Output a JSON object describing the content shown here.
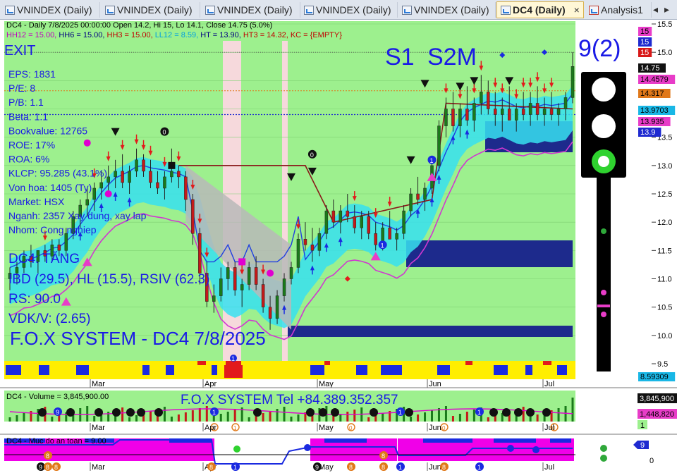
{
  "tabs": [
    {
      "label": "VNINDEX (Daily)"
    },
    {
      "label": "VNINDEX (Daily)"
    },
    {
      "label": "VNINDEX (Daily)"
    },
    {
      "label": "VNINDEX (Daily)"
    },
    {
      "label": "VNINDEX (Daily)"
    },
    {
      "label": "DC4 (Daily)",
      "close": "×"
    },
    {
      "label": "Analysis1"
    }
  ],
  "header": {
    "line1": "DC4 - Daily 7/8/2025 00:00:00 Open 14.2, Hi 15, Lo 14.1, Close 14.75 (5.0%)",
    "line2": [
      {
        "text": "HH12 = 15.00, ",
        "color": "#c000c0"
      },
      {
        "text": "HH6 = 15.00, ",
        "color": "#000080"
      },
      {
        "text": "HH3 = 15.00, ",
        "color": "#c00000"
      },
      {
        "text": "LL12 = 8.59, ",
        "color": "#00a0e0"
      },
      {
        "text": "HT  = 13.90, ",
        "color": "#000080"
      },
      {
        "text": "HT3  = 14.32, ",
        "color": "#c00000"
      },
      {
        "text": "KC = {EMPTY}",
        "color": "#c00000"
      }
    ]
  },
  "signal": {
    "exit": "EXIT",
    "s1": "S1",
    "s2m": "S2M",
    "score": "9(2)"
  },
  "fundamentals": [
    "EPS: 1831",
    "P/E: 8",
    "P/B: 1.1",
    "Beta: 1.1",
    "Bookvalue: 12765",
    "ROE: 17%",
    "ROA: 6%",
    "KLCP: 95.285 (43.1%)",
    "Von hoa: 1405 (Ty)",
    "Market: HSX",
    "Nganh: 2357 Xay dung, xay lap",
    "Nhom: Cong nghiep"
  ],
  "status": {
    "trend": "DC4: TĂNG",
    "ibd": "IBD (29.5), HL (15.5), RSIV (62.3)",
    "rs": "RS: 90.0",
    "vdk": "VDK/V:  (2.65)"
  },
  "system_title": "F.O.X SYSTEM - DC4 7/8/2025",
  "volume_panel": {
    "label": "DC4 - Volume = 3,845,900.00",
    "banner": "F.O.X SYSTEM Tel +84.389.352.357",
    "badge_top": "3,845,900",
    "badge_mid": "1,448,820",
    "badge_low": "1"
  },
  "safety_panel": {
    "label": "DC4 - Muc do an toan = 9.00",
    "badge": "9",
    "axis_zero": "0"
  },
  "price_axis": {
    "ticks": [
      "15.5",
      "15.0",
      "14.5",
      "14.0",
      "13.5",
      "13.0",
      "12.5",
      "12.0",
      "11.5",
      "11.0",
      "10.5",
      "10.0",
      "9.5"
    ],
    "badges": [
      {
        "text": "15",
        "bg": "#e83cc8"
      },
      {
        "text": "15",
        "bg": "#1e2ad0"
      },
      {
        "text": "15",
        "bg": "#d81818"
      },
      {
        "text": "14.75",
        "bg": "#111111"
      },
      {
        "text": "14.4579",
        "bg": "#e83cc8"
      },
      {
        "text": "14.317",
        "bg": "#e0781a"
      },
      {
        "text": "13.9703",
        "bg": "#19b7e6"
      },
      {
        "text": "13.935",
        "bg": "#e83cc8"
      },
      {
        "text": "13.9",
        "bg": "#1e2ad0"
      },
      {
        "text": "8.59309",
        "bg": "#19b7e6"
      }
    ]
  },
  "months": [
    "Mar",
    "Apr",
    "May",
    "Jun",
    "Jul"
  ],
  "markers": {
    "zero": "0",
    "one": "1",
    "eight": "8",
    "nine": "9"
  },
  "chart_data": {
    "type": "candlestick",
    "yrange": [
      9.5,
      15.5
    ],
    "candles": [
      [
        11.0,
        11.2,
        10.8,
        11.1
      ],
      [
        11.1,
        11.3,
        10.9,
        11.2
      ],
      [
        11.2,
        11.5,
        11.1,
        11.4
      ],
      [
        11.4,
        11.6,
        11.2,
        11.3
      ],
      [
        11.3,
        11.5,
        11.1,
        11.5
      ],
      [
        11.5,
        11.6,
        11.3,
        11.4
      ],
      [
        11.4,
        11.7,
        11.3,
        11.6
      ],
      [
        11.6,
        11.7,
        11.4,
        11.5
      ],
      [
        11.5,
        11.9,
        11.4,
        11.8
      ],
      [
        11.8,
        12.2,
        11.7,
        12.1
      ],
      [
        12.1,
        12.4,
        11.9,
        12.3
      ],
      [
        12.3,
        12.6,
        12.1,
        12.4
      ],
      [
        12.4,
        12.7,
        12.2,
        12.6
      ],
      [
        12.6,
        12.9,
        12.4,
        12.7
      ],
      [
        12.7,
        13.0,
        12.5,
        12.8
      ],
      [
        12.8,
        13.1,
        12.6,
        12.9
      ],
      [
        12.9,
        13.2,
        12.6,
        12.7
      ],
      [
        12.7,
        13.0,
        12.5,
        12.9
      ],
      [
        12.9,
        13.3,
        12.8,
        13.1
      ],
      [
        13.1,
        13.2,
        12.8,
        12.9
      ],
      [
        12.9,
        13.1,
        12.6,
        12.7
      ],
      [
        12.7,
        12.9,
        12.5,
        12.6
      ],
      [
        12.6,
        12.9,
        12.4,
        12.8
      ],
      [
        12.8,
        13.3,
        12.7,
        12.9
      ],
      [
        12.9,
        13.0,
        12.6,
        12.8
      ],
      [
        12.8,
        12.9,
        12.2,
        12.4
      ],
      [
        12.4,
        12.5,
        11.6,
        11.8
      ],
      [
        11.8,
        11.9,
        10.9,
        11.1
      ],
      [
        11.1,
        11.3,
        10.5,
        10.6
      ],
      [
        10.6,
        10.9,
        10.4,
        10.7
      ],
      [
        10.7,
        11.2,
        10.6,
        11.0
      ],
      [
        11.0,
        11.3,
        10.8,
        11.2
      ],
      [
        11.2,
        11.3,
        10.7,
        10.8
      ],
      [
        10.8,
        11.0,
        10.5,
        10.9
      ],
      [
        10.9,
        11.3,
        10.8,
        11.2
      ],
      [
        11.2,
        11.4,
        10.8,
        10.9
      ],
      [
        10.9,
        11.0,
        10.4,
        10.5
      ],
      [
        10.5,
        10.7,
        10.1,
        10.3
      ],
      [
        10.3,
        10.8,
        10.2,
        10.7
      ],
      [
        10.7,
        11.1,
        10.6,
        11.0
      ],
      [
        11.0,
        11.3,
        10.9,
        11.2
      ],
      [
        11.2,
        11.8,
        11.1,
        11.7
      ],
      [
        11.7,
        12.0,
        11.5,
        11.6
      ],
      [
        11.6,
        11.9,
        11.3,
        11.5
      ],
      [
        11.5,
        11.9,
        11.4,
        11.8
      ],
      [
        11.8,
        12.3,
        11.7,
        12.2
      ],
      [
        12.2,
        12.4,
        11.9,
        12.0
      ],
      [
        12.0,
        12.3,
        11.8,
        12.2
      ],
      [
        12.2,
        12.5,
        12.0,
        12.1
      ],
      [
        12.1,
        12.3,
        11.8,
        11.9
      ],
      [
        11.9,
        12.2,
        11.7,
        12.1
      ],
      [
        12.1,
        12.2,
        11.7,
        11.8
      ],
      [
        11.8,
        12.0,
        11.5,
        11.6
      ],
      [
        11.6,
        12.0,
        11.5,
        11.9
      ],
      [
        11.9,
        12.2,
        11.7,
        11.7
      ],
      [
        11.7,
        11.9,
        11.5,
        11.8
      ],
      [
        11.8,
        12.3,
        11.7,
        12.2
      ],
      [
        12.2,
        12.6,
        12.1,
        12.5
      ],
      [
        12.5,
        12.8,
        12.3,
        12.4
      ],
      [
        12.4,
        12.7,
        12.2,
        12.6
      ],
      [
        12.6,
        13.1,
        12.5,
        13.0
      ],
      [
        13.0,
        13.8,
        12.9,
        13.7
      ],
      [
        13.7,
        14.2,
        13.5,
        14.0
      ],
      [
        14.0,
        14.3,
        13.6,
        13.7
      ],
      [
        13.7,
        14.1,
        13.5,
        14.0
      ],
      [
        14.0,
        14.4,
        13.7,
        13.8
      ],
      [
        13.8,
        14.2,
        13.6,
        14.1
      ],
      [
        14.1,
        14.6,
        13.9,
        14.3
      ],
      [
        14.3,
        14.5,
        13.9,
        14.0
      ],
      [
        14.0,
        14.3,
        13.7,
        13.9
      ],
      [
        13.9,
        14.2,
        13.6,
        14.0
      ],
      [
        14.0,
        14.4,
        13.8,
        13.8
      ],
      [
        13.8,
        14.1,
        13.6,
        14.0
      ],
      [
        14.0,
        14.3,
        13.8,
        13.9
      ],
      [
        13.9,
        14.3,
        13.7,
        14.1
      ],
      [
        14.1,
        14.4,
        13.8,
        13.9
      ],
      [
        13.9,
        14.2,
        13.7,
        14.0
      ],
      [
        14.0,
        14.3,
        13.8,
        13.9
      ],
      [
        13.9,
        14.1,
        13.7,
        14.0
      ],
      [
        14.0,
        14.3,
        13.8,
        14.2
      ],
      [
        14.2,
        15.0,
        14.1,
        14.75
      ]
    ]
  }
}
